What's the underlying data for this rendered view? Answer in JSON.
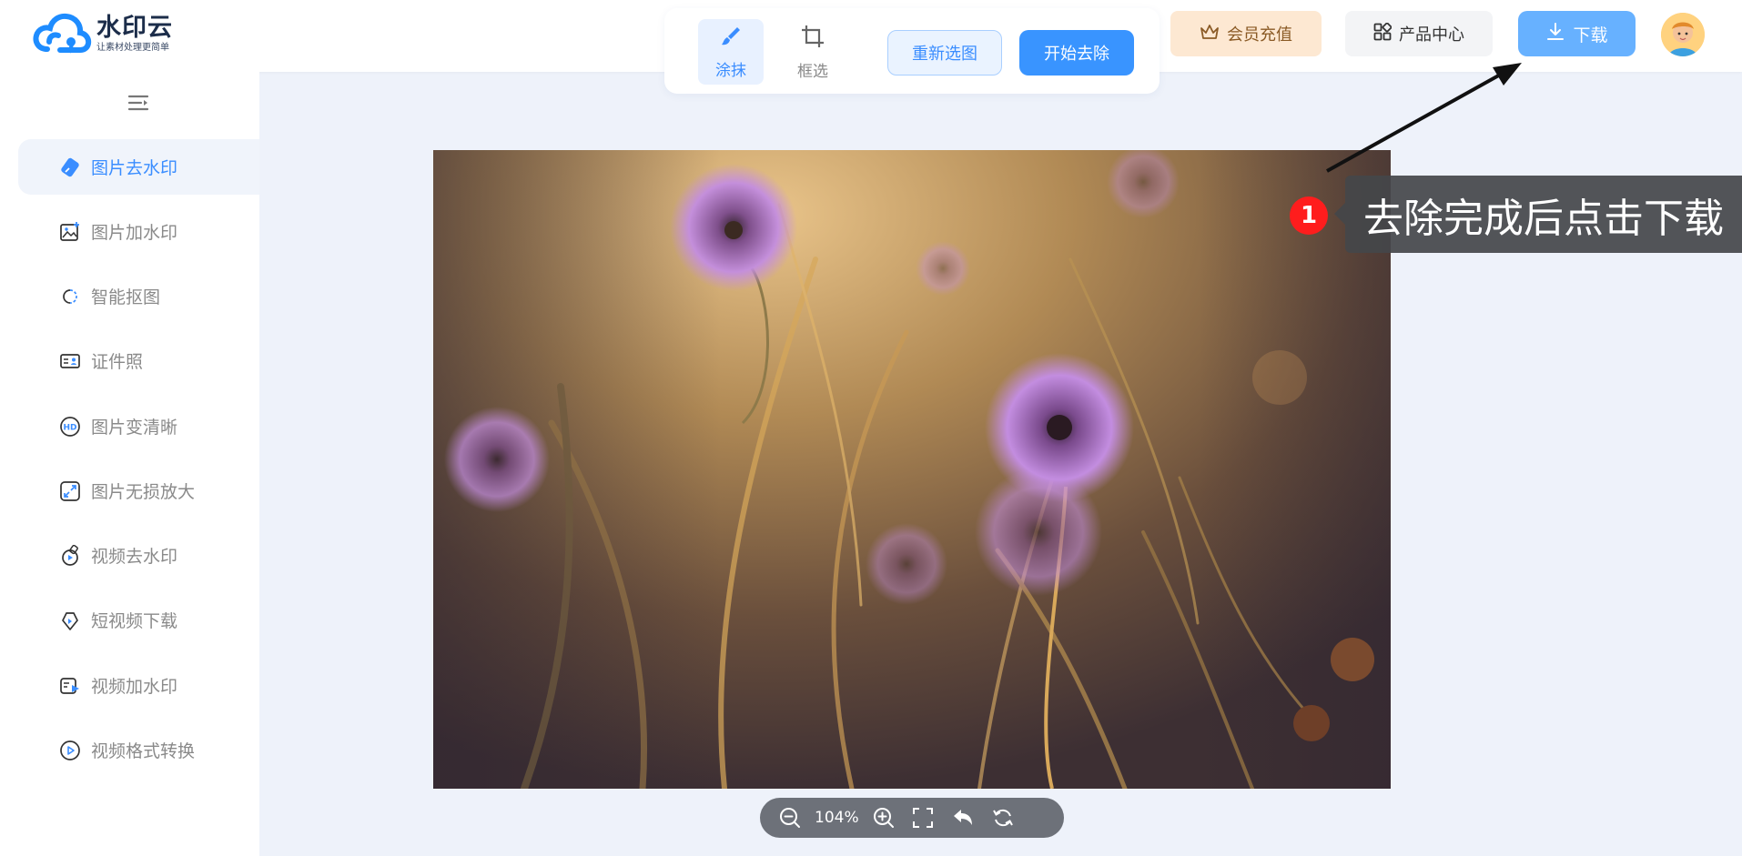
{
  "header": {
    "logo": {
      "name": "水印云",
      "slogan": "让素材处理更简单",
      "icon": "cloud-logo-icon"
    },
    "tools": [
      {
        "label": "涂抹",
        "icon": "brush-icon",
        "active": true
      },
      {
        "label": "框选",
        "icon": "crop-icon",
        "active": false
      }
    ],
    "reselect_label": "重新选图",
    "start_label": "开始去除",
    "member_label": "会员充值",
    "products_label": "产品中心",
    "download_label": "下载"
  },
  "sidebar": {
    "items": [
      {
        "label": "图片去水印",
        "icon": "eraser-icon",
        "active": true
      },
      {
        "label": "图片加水印",
        "icon": "image-add-icon",
        "active": false
      },
      {
        "label": "智能抠图",
        "icon": "cutout-icon",
        "active": false
      },
      {
        "label": "证件照",
        "icon": "id-card-icon",
        "active": false
      },
      {
        "label": "图片变清晰",
        "icon": "hd-icon",
        "active": false
      },
      {
        "label": "图片无损放大",
        "icon": "enlarge-icon",
        "active": false
      },
      {
        "label": "视频去水印",
        "icon": "video-eraser-icon",
        "active": false
      },
      {
        "label": "短视频下载",
        "icon": "short-video-icon",
        "active": false
      },
      {
        "label": "视频加水印",
        "icon": "video-add-icon",
        "active": false
      },
      {
        "label": "视频格式转换",
        "icon": "video-convert-icon",
        "active": false
      }
    ]
  },
  "canvas": {
    "zoom": "104%"
  },
  "annotation": {
    "step": "1",
    "text": "去除完成后点击下载"
  },
  "colors": {
    "accent": "#3a8dff",
    "primary_button": "#3994ff",
    "download_button": "#67b1ff",
    "member_bg": "#fde8d2",
    "badge": "#ff1d1d",
    "page_bg": "#eef2fa"
  }
}
